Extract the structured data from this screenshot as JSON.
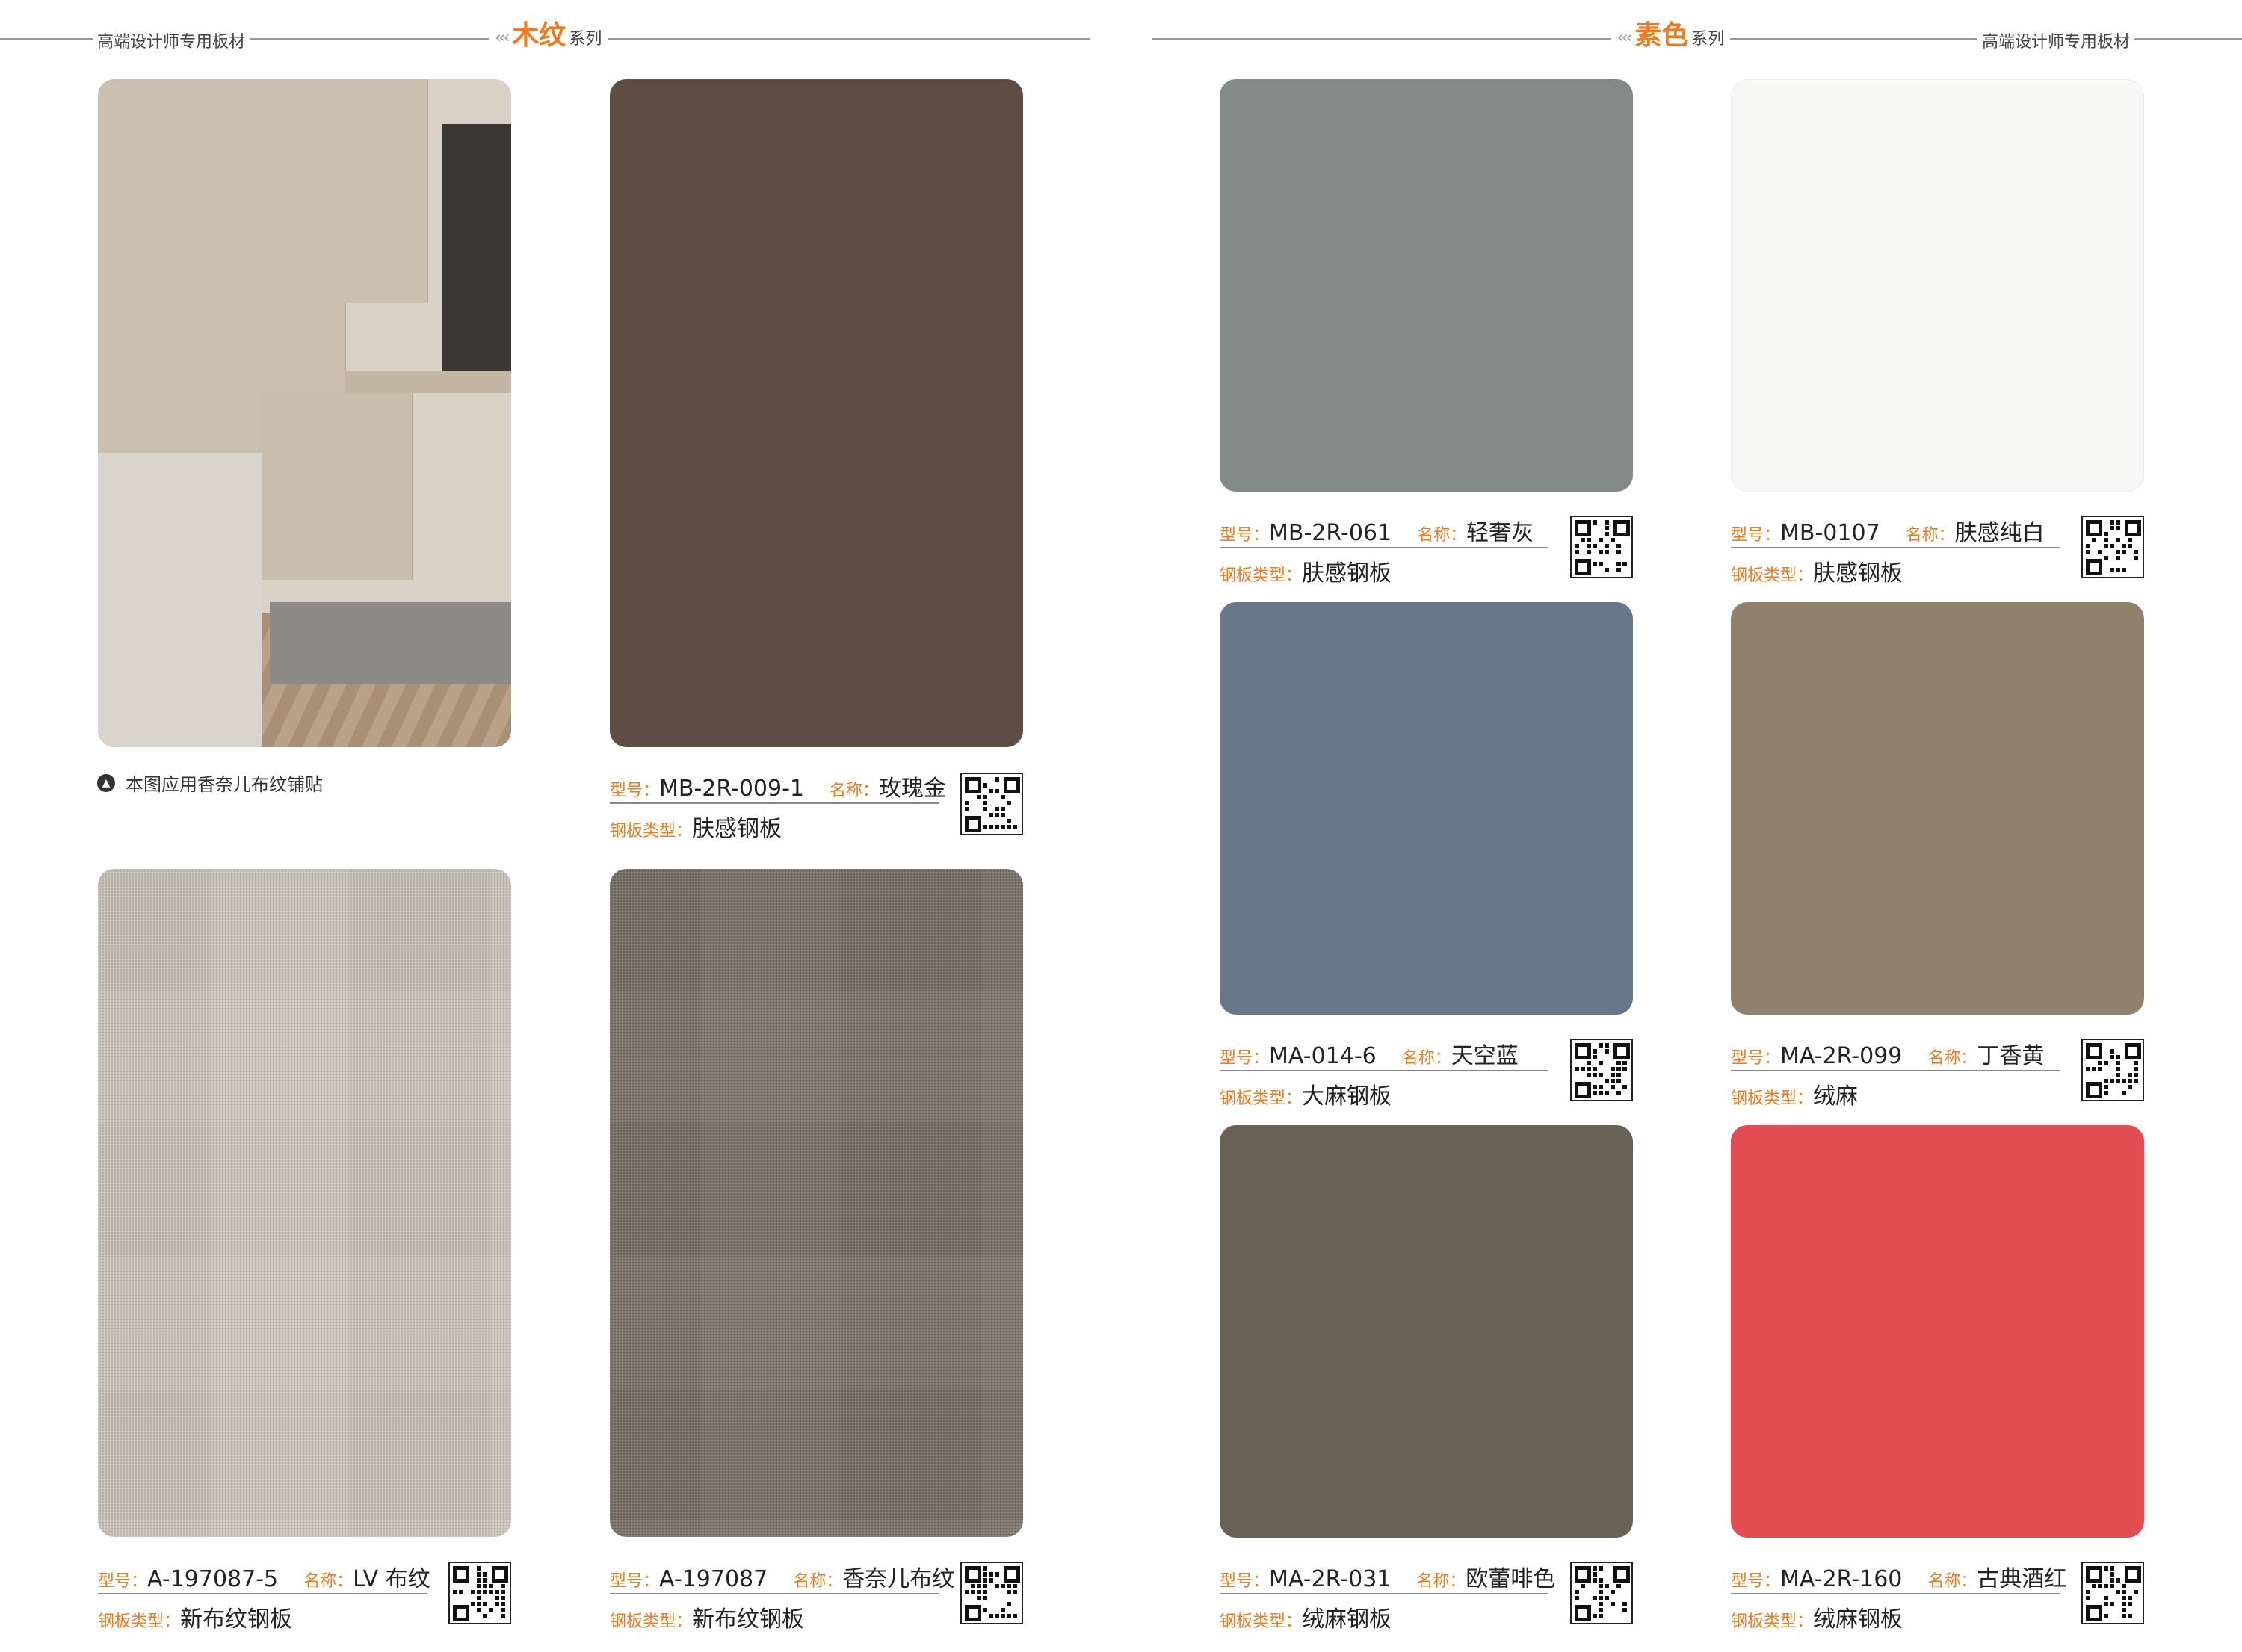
{
  "header": {
    "brand_left": "高端设计师专用板材",
    "brand_right": "高端设计师专用板材",
    "left_series": {
      "name": "木纹",
      "suffix": "系列"
    },
    "right_series": {
      "name": "素色",
      "suffix": "系列"
    },
    "chevrons": "‹‹‹"
  },
  "caption": "本图应用香奈儿布纹铺贴",
  "labels": {
    "model": "型号：",
    "name": "名称：",
    "type": "钢板类型："
  },
  "colors": {
    "accent": "#ee7b1f"
  },
  "products": [
    {
      "model": "MB-2R-009-1",
      "name": "玫瑰金",
      "type": "肤感钢板",
      "color": "#5d4d44"
    },
    {
      "model": "A-197087-5",
      "name": "LV 布纹",
      "type": "新布纹钢板",
      "color": "#c8c1b6"
    },
    {
      "model": "A-197087",
      "name": "香奈儿布纹",
      "type": "新布纹钢板",
      "color": "#7d7469"
    },
    {
      "model": "MB-2R-061",
      "name": "轻奢灰",
      "type": "肤感钢板",
      "color": "#828b87"
    },
    {
      "model": "MB-0107",
      "name": "肤感纯白",
      "type": "肤感钢板",
      "color": "#f7f7f6"
    },
    {
      "model": "MA-014-6",
      "name": "天空蓝",
      "type": "大麻钢板",
      "color": "#66788a"
    },
    {
      "model": "MA-2R-099",
      "name": "丁香黄",
      "type": "绒麻",
      "color": "#8f816c"
    },
    {
      "model": "MA-2R-031",
      "name": "欧蕾啡色",
      "type": "绒麻钢板",
      "color": "#6a6257"
    },
    {
      "model": "MA-2R-160",
      "name": "古典酒红",
      "type": "绒麻钢板",
      "color": "#e24c53"
    }
  ]
}
